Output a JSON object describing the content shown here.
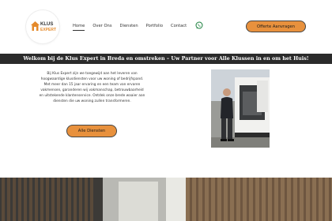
{
  "header": {
    "logo": {
      "klus": "KLUS",
      "expert": "EXPERT"
    },
    "nav": [
      {
        "label": "Home",
        "active": true
      },
      {
        "label": "Over Ons",
        "active": false
      },
      {
        "label": "Diensten",
        "active": false
      },
      {
        "label": "Portfolio",
        "active": false
      },
      {
        "label": "Contact",
        "active": false
      }
    ],
    "whatsapp_icon": "whatsapp-icon",
    "cta_label": "Offerte Aanvragen"
  },
  "banner": {
    "text": "Welkom bij de Klus Expert in Breda en omstreken – Uw Partner voor Alle Klussen in en om het Huis!"
  },
  "intro": {
    "text": "Bij Klus Expert zijn we toegewijd aan het leveren van hoogwaardige klusdiensten voor uw woning of bedrijfspand. Met meer dan 15 jaar ervaring en een team van ervaren vakmensen, garanderen wij vakmanschap, betrouwbaarheid en uitstekende klantenservice. Ontdek onze brede waaier aan diensten die uw woning zullen transformeren.",
    "button_label": "Alle Diensten"
  },
  "colors": {
    "accent": "#e8913d",
    "banner_bg": "#2b2b2b"
  }
}
